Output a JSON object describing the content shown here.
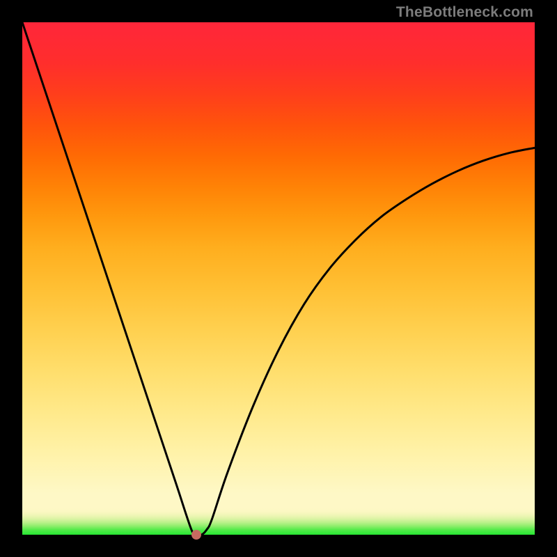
{
  "watermark": "TheBottleneck.com",
  "colors": {
    "frame": "#000000",
    "curve_stroke": "#000000",
    "dot_fill": "#c76a60",
    "watermark_text": "#7c7c7c"
  },
  "chart_data": {
    "type": "line",
    "title": "",
    "xlabel": "",
    "ylabel": "",
    "xlim": [
      0,
      100
    ],
    "ylim": [
      0,
      100
    ],
    "grid": false,
    "legend": false,
    "series": [
      {
        "name": "bottleneck-curve",
        "x": [
          0,
          5,
          10,
          15,
          20,
          25,
          30,
          33,
          34,
          35,
          36,
          37,
          40,
          45,
          50,
          55,
          60,
          65,
          70,
          75,
          80,
          85,
          90,
          95,
          100
        ],
        "values": [
          100,
          85,
          70,
          55,
          40,
          25,
          10,
          1,
          0,
          0,
          1,
          3,
          12,
          25,
          36,
          45,
          52,
          57.5,
          62,
          65.5,
          68.5,
          71,
          73,
          74.5,
          75.5
        ]
      }
    ],
    "markers": [
      {
        "name": "optimal-point",
        "x": 34,
        "y": 0
      }
    ],
    "background_gradient": {
      "direction": "vertical",
      "stops": [
        {
          "pos": 0.0,
          "color": "#27e833"
        },
        {
          "pos": 0.05,
          "color": "#fef8c6"
        },
        {
          "pos": 0.5,
          "color": "#ffc034"
        },
        {
          "pos": 1.0,
          "color": "#ff263a"
        }
      ]
    }
  }
}
